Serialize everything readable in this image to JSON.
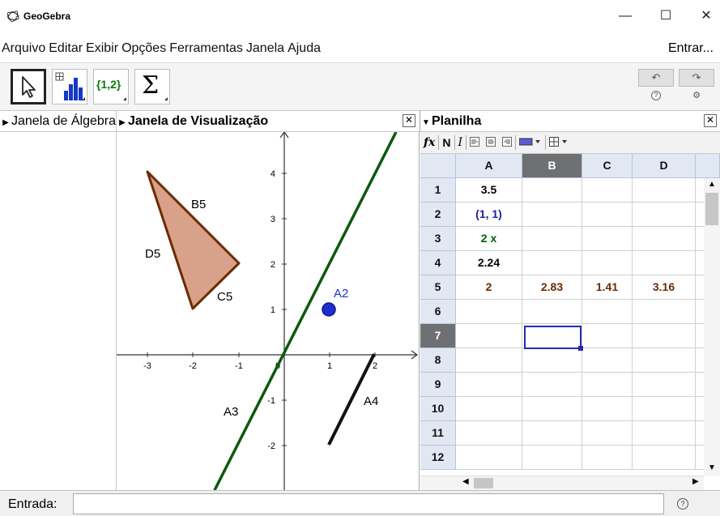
{
  "window": {
    "title": "GeoGebra",
    "minimize_glyph": "—",
    "maximize_glyph": "☐",
    "close_glyph": "✕"
  },
  "menu": {
    "items": [
      "Arquivo",
      "Editar",
      "Exibir",
      "Opções",
      "Ferramentas",
      "Janela",
      "Ajuda"
    ],
    "login": "Entrar..."
  },
  "toolbar": {
    "tools": [
      "move-tool",
      "chart-tool",
      "list-tool",
      "sum-tool"
    ],
    "list_label": "{1,2}",
    "sum_label": "Σ",
    "undo_glyph": "↶",
    "redo_glyph": "↷",
    "help_glyph": "?",
    "settings_glyph": "⚙"
  },
  "panels": {
    "algebra_title": "Janela de Álgebra",
    "graphics_title": "Janela de Visualização",
    "spreadsheet_title": "Planilha"
  },
  "spreadsheet_toolbar": {
    "fx": "fx",
    "bold": "N",
    "italic": "I"
  },
  "spreadsheet": {
    "columns": [
      "A",
      "B",
      "C",
      "D"
    ],
    "selected_column": "B",
    "selected_row": "7",
    "rows": [
      {
        "num": "1",
        "cells": [
          "3.5",
          "",
          "",
          ""
        ],
        "color": "#000000"
      },
      {
        "num": "2",
        "cells": [
          "(1, 1)",
          "",
          "",
          ""
        ],
        "color": "#1f1fa3"
      },
      {
        "num": "3",
        "cells": [
          "2 x",
          "",
          "",
          ""
        ],
        "color": "#006400"
      },
      {
        "num": "4",
        "cells": [
          "2.24",
          "",
          "",
          ""
        ],
        "color": "#000000"
      },
      {
        "num": "5",
        "cells": [
          "2",
          "2.83",
          "1.41",
          "3.16"
        ],
        "color": "#6b2b00"
      },
      {
        "num": "6",
        "cells": [
          "",
          "",
          "",
          ""
        ],
        "color": "#000000"
      },
      {
        "num": "7",
        "cells": [
          "",
          "",
          "",
          ""
        ],
        "color": "#000000"
      },
      {
        "num": "8",
        "cells": [
          "",
          "",
          "",
          ""
        ],
        "color": "#000000"
      },
      {
        "num": "9",
        "cells": [
          "",
          "",
          "",
          ""
        ],
        "color": "#000000"
      },
      {
        "num": "10",
        "cells": [
          "",
          "",
          "",
          ""
        ],
        "color": "#000000"
      },
      {
        "num": "11",
        "cells": [
          "",
          "",
          "",
          ""
        ],
        "color": "#000000"
      },
      {
        "num": "12",
        "cells": [
          "",
          "",
          "",
          ""
        ],
        "color": "#000000"
      }
    ]
  },
  "graphics": {
    "x_ticks": [
      "-3",
      "-2",
      "-1",
      "0",
      "1",
      "2"
    ],
    "y_ticks": [
      "4",
      "3",
      "2",
      "1",
      "-1",
      "-2"
    ],
    "labels": {
      "B5": "B5",
      "D5": "D5",
      "C5": "C5",
      "A2": "A2",
      "A3": "A3",
      "A4": "A4"
    },
    "colors": {
      "triangle_fill": "#d9a08a",
      "triangle_stroke": "#6b2b00",
      "line": "#0b5a0b",
      "point": "#1c2fcc",
      "segment": "#111111"
    }
  },
  "input_bar": {
    "label": "Entrada:",
    "value": "",
    "help_glyph": "?"
  }
}
